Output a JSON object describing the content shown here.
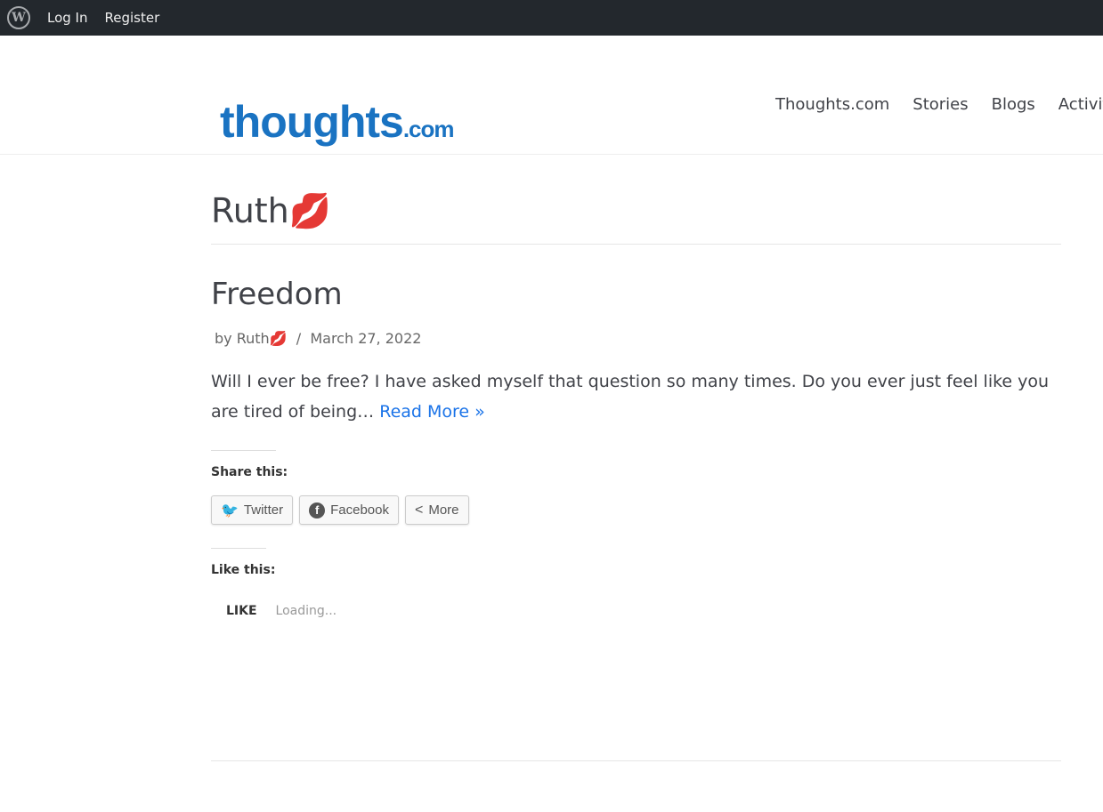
{
  "adminbar": {
    "logo_icon": "wordpress-icon",
    "login": "Log In",
    "register": "Register"
  },
  "header": {
    "logo_text": "thoughts",
    "logo_suffix": ".com",
    "nav": [
      "Thoughts.com",
      "Stories",
      "Blogs",
      "Activity"
    ]
  },
  "archive": {
    "title": "Ruth💋"
  },
  "post": {
    "title": "Freedom",
    "by": "by",
    "author": "Ruth💋",
    "sep": "/",
    "date": "March 27, 2022",
    "excerpt": "Will I ever be free? I have asked myself that question so many times. Do you ever just feel like you are tired of being…",
    "read_more": "Read More »"
  },
  "share": {
    "heading": "Share this:",
    "buttons": [
      {
        "label": "Twitter",
        "icon": "twitter-icon"
      },
      {
        "label": "Facebook",
        "icon": "facebook-icon"
      },
      {
        "label": "More",
        "icon": "share-icon"
      }
    ]
  },
  "like": {
    "heading": "Like this:",
    "button": "LIKE",
    "status": "Loading..."
  }
}
